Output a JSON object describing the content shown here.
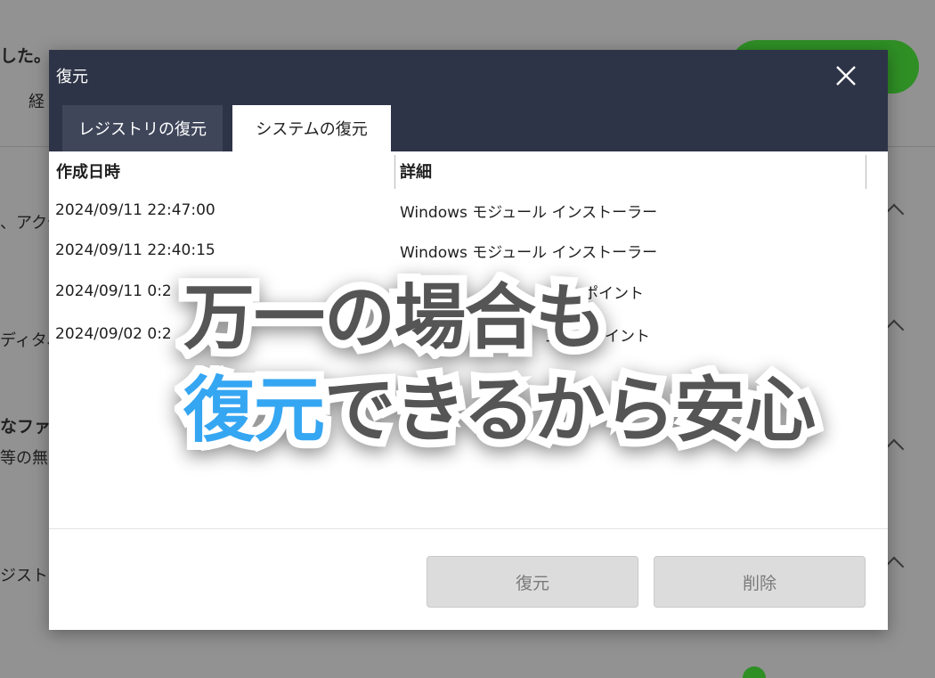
{
  "background": {
    "texts": {
      "t1": "した。",
      "t2": "経",
      "t3": "、アクセ",
      "t4": "ディタ、",
      "t5": "なファー",
      "t6": "等の無",
      "t7": "ジスト"
    }
  },
  "dialog": {
    "title": "復元",
    "close_label": "×",
    "tabs": [
      {
        "label": "レジストリの復元",
        "active": false
      },
      {
        "label": "システムの復元",
        "active": true
      }
    ],
    "table": {
      "columns": [
        "作成日時",
        "詳細"
      ],
      "rows": [
        {
          "date": "2024/09/11 22:47:00",
          "detail": "Windows モジュール インストーラー"
        },
        {
          "date": "2024/09/11 22:40:15",
          "detail": "Windows モジュール インストーラー"
        },
        {
          "date": "2024/09/11 0:2",
          "detail": "ックポイント"
        },
        {
          "date": "2024/09/02 0:2",
          "detail": "ェックポイント"
        }
      ]
    },
    "buttons": {
      "restore": "復元",
      "delete": "削除"
    }
  },
  "overlay": {
    "line1": "万一の場合も",
    "line2_accent": "復元",
    "line2_rest": "できるから安心"
  },
  "colors": {
    "titlebar": "#2e3447",
    "accent_blue": "#35a6f2",
    "green": "#2f8f25"
  }
}
